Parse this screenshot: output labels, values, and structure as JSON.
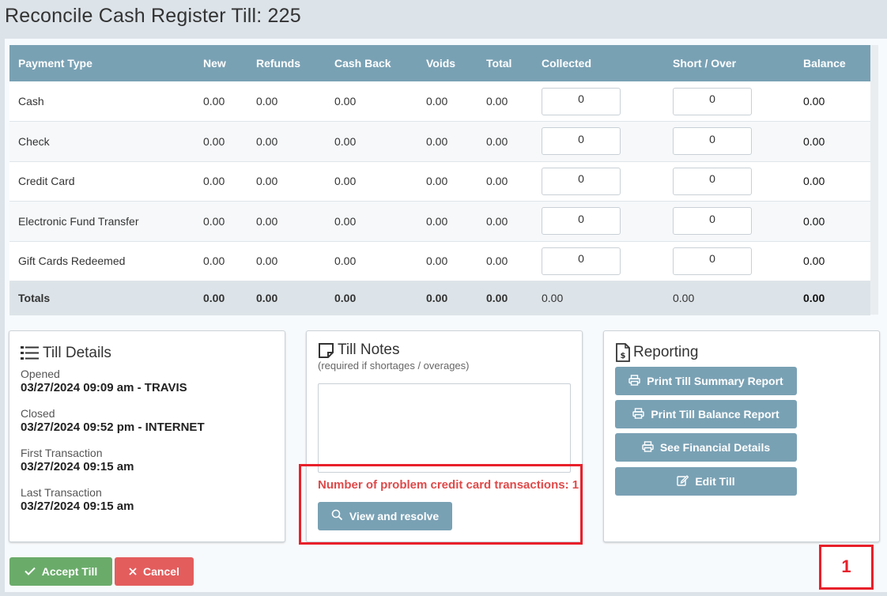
{
  "header": {
    "title": "Reconcile Cash Register Till: 225"
  },
  "table": {
    "columns": [
      "Payment Type",
      "New",
      "Refunds",
      "Cash Back",
      "Voids",
      "Total",
      "Collected",
      "Short / Over",
      "Balance"
    ],
    "rows": [
      {
        "type": "Cash",
        "new": "0.00",
        "refunds": "0.00",
        "cashback": "0.00",
        "voids": "0.00",
        "total": "0.00",
        "collected": "0",
        "shortover": "0",
        "balance": "0.00"
      },
      {
        "type": "Check",
        "new": "0.00",
        "refunds": "0.00",
        "cashback": "0.00",
        "voids": "0.00",
        "total": "0.00",
        "collected": "0",
        "shortover": "0",
        "balance": "0.00"
      },
      {
        "type": "Credit Card",
        "new": "0.00",
        "refunds": "0.00",
        "cashback": "0.00",
        "voids": "0.00",
        "total": "0.00",
        "collected": "0",
        "shortover": "0",
        "balance": "0.00"
      },
      {
        "type": "Electronic Fund Transfer",
        "new": "0.00",
        "refunds": "0.00",
        "cashback": "0.00",
        "voids": "0.00",
        "total": "0.00",
        "collected": "0",
        "shortover": "0",
        "balance": "0.00"
      },
      {
        "type": "Gift Cards Redeemed",
        "new": "0.00",
        "refunds": "0.00",
        "cashback": "0.00",
        "voids": "0.00",
        "total": "0.00",
        "collected": "0",
        "shortover": "0",
        "balance": "0.00"
      }
    ],
    "totals": {
      "label": "Totals",
      "new": "0.00",
      "refunds": "0.00",
      "cashback": "0.00",
      "voids": "0.00",
      "total": "0.00",
      "collected": "0.00",
      "shortover": "0.00",
      "balance": "0.00"
    }
  },
  "till_details": {
    "title": "Till Details",
    "opened_label": "Opened",
    "opened_value": "03/27/2024 09:09 am - TRAVIS",
    "closed_label": "Closed",
    "closed_value": "03/27/2024 09:52 pm - INTERNET",
    "first_label": "First Transaction",
    "first_value": "03/27/2024 09:15 am",
    "last_label": "Last Transaction",
    "last_value": "03/27/2024 09:15 am"
  },
  "till_notes": {
    "title": "Till Notes",
    "subtitle": "(required if shortages / overages)",
    "notes_value": "",
    "problem_text": "Number of problem credit card transactions: 1",
    "view_resolve_label": "View and resolve"
  },
  "reporting": {
    "title": "Reporting",
    "print_summary_label": "Print Till Summary Report",
    "print_balance_label": "Print Till Balance Report",
    "financial_label": "See Financial Details",
    "edit_label": "Edit Till"
  },
  "footer": {
    "accept_label": "Accept Till",
    "cancel_label": "Cancel",
    "annotation_number": "1"
  },
  "colors": {
    "header_accent": "#79a1b4",
    "accept": "#6aab6a",
    "cancel": "#e35d5d",
    "warning_text": "#df4a4a",
    "highlight_box": "#e8202a"
  }
}
